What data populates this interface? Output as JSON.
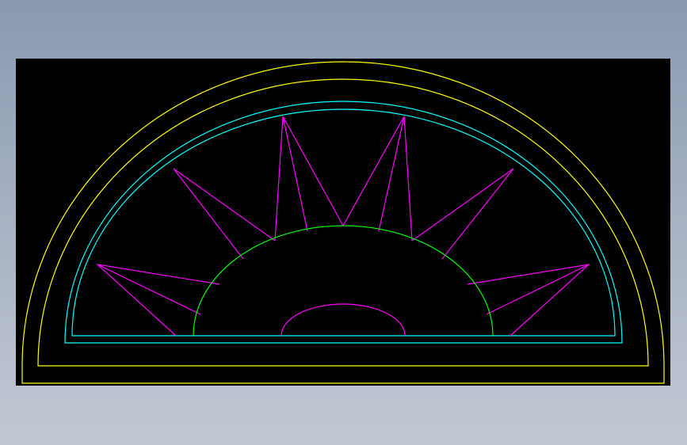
{
  "viewport": {
    "background_gradient": [
      "#8a99b0",
      "#a4afc1",
      "#c2c8d3"
    ]
  },
  "drawing": {
    "background_color": "#000000",
    "entities": [
      {
        "name": "outer-frame-outline",
        "color": "#ffff00",
        "layer": "frame"
      },
      {
        "name": "inner-frame-outline",
        "color": "#ffff00",
        "layer": "frame"
      },
      {
        "name": "glazing-outer-outline",
        "color": "#00ffff",
        "layer": "glazing"
      },
      {
        "name": "glazing-inner-outline",
        "color": "#00ffff",
        "layer": "glazing"
      },
      {
        "name": "hub-arc",
        "color": "#00ff00",
        "layer": "hub"
      },
      {
        "name": "center-arc",
        "color": "#ff00ff",
        "layer": "ornament"
      },
      {
        "name": "sunburst-rays",
        "color": "#ff00ff",
        "layer": "ornament",
        "ray_count": 6
      }
    ]
  }
}
